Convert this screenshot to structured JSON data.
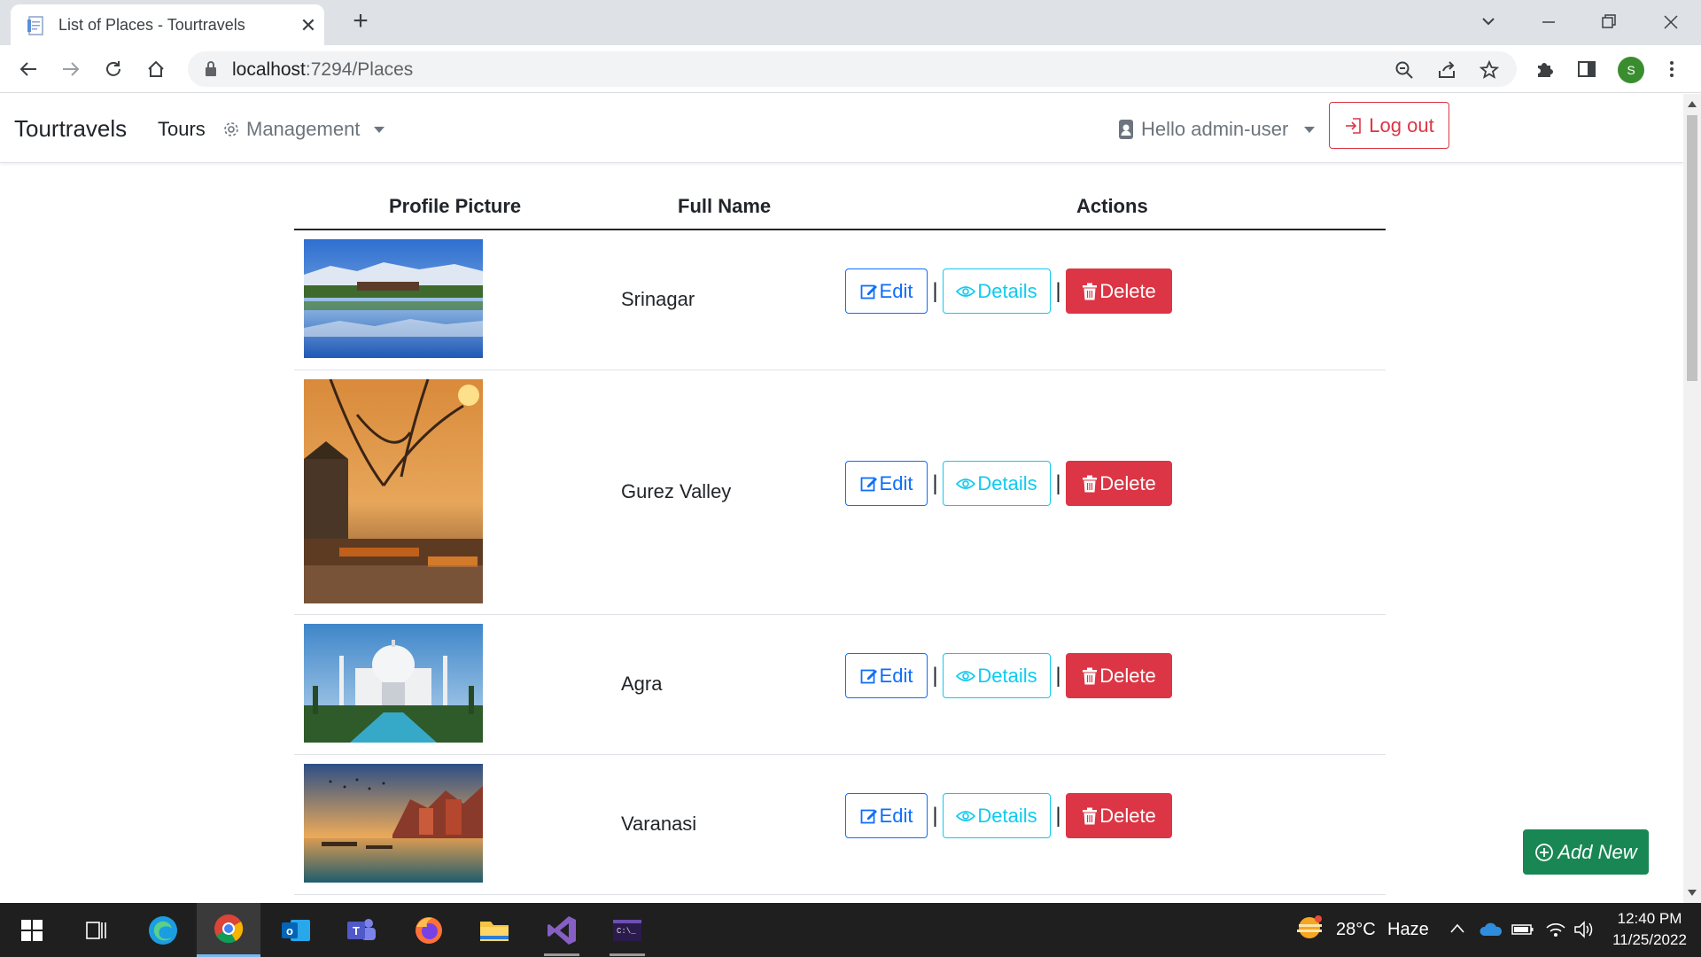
{
  "browser": {
    "tab_title": "List of Places - Tourtravels",
    "close_glyph": "✕",
    "newtab_glyph": "+",
    "url_host": "localhost",
    "url_path": ":7294/Places",
    "profile_initial": "S"
  },
  "navbar": {
    "brand": "Tourtravels",
    "tours": "Tours",
    "management": "Management",
    "user": "Hello admin-user",
    "logout": "Log out"
  },
  "table": {
    "headers": [
      "Profile Picture",
      "Full Name",
      "Actions"
    ],
    "rows": [
      {
        "name": "Srinagar"
      },
      {
        "name": "Gurez Valley"
      },
      {
        "name": "Agra"
      },
      {
        "name": "Varanasi"
      }
    ],
    "edit_label": "Edit",
    "details_label": "Details",
    "delete_label": "Delete",
    "separator": "|"
  },
  "add_new": "Add New",
  "taskbar": {
    "temperature": "28°C",
    "weather": "Haze",
    "time": "12:40 PM",
    "date": "11/25/2022"
  },
  "colors": {
    "primary": "#0d6efd",
    "info": "#0dcaf0",
    "danger": "#dc3545",
    "success": "#198754"
  }
}
